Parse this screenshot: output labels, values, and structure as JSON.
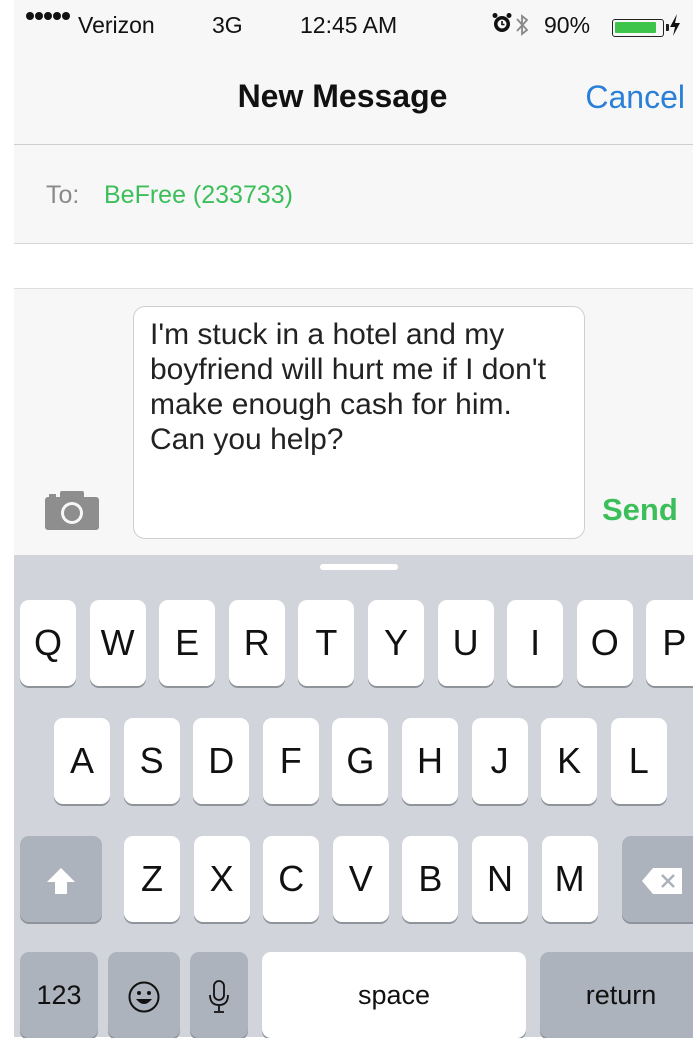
{
  "status_bar": {
    "carrier": "Verizon",
    "network": "3G",
    "time": "12:45 AM",
    "battery_percent": "90%",
    "battery_level": 0.9,
    "icons": [
      "signal-dots-icon",
      "alarm-icon",
      "bluetooth-icon",
      "battery-icon",
      "charging-bolt-icon"
    ]
  },
  "nav": {
    "title": "New Message",
    "cancel_label": "Cancel"
  },
  "recipient": {
    "label": "To:",
    "value": "BeFree (233733)"
  },
  "compose": {
    "message": "I'm stuck in a hotel and my boyfriend will hurt me if I don't make enough cash for him. Can you help?",
    "send_label": "Send",
    "camera_icon": "camera-icon"
  },
  "keyboard": {
    "row1": [
      "Q",
      "W",
      "E",
      "R",
      "T",
      "Y",
      "U",
      "I",
      "O",
      "P"
    ],
    "row2": [
      "A",
      "S",
      "D",
      "F",
      "G",
      "H",
      "J",
      "K",
      "L"
    ],
    "row3": [
      "Z",
      "X",
      "C",
      "V",
      "B",
      "N",
      "M"
    ],
    "numbers_label": "123",
    "space_label": "space",
    "return_label": "return",
    "icons": [
      "shift-icon",
      "delete-icon",
      "emoji-icon",
      "microphone-icon"
    ]
  },
  "colors": {
    "accent_blue": "#2a7fd9",
    "accent_green": "#3cbf5a",
    "keyboard_bg": "#d1d5db"
  }
}
